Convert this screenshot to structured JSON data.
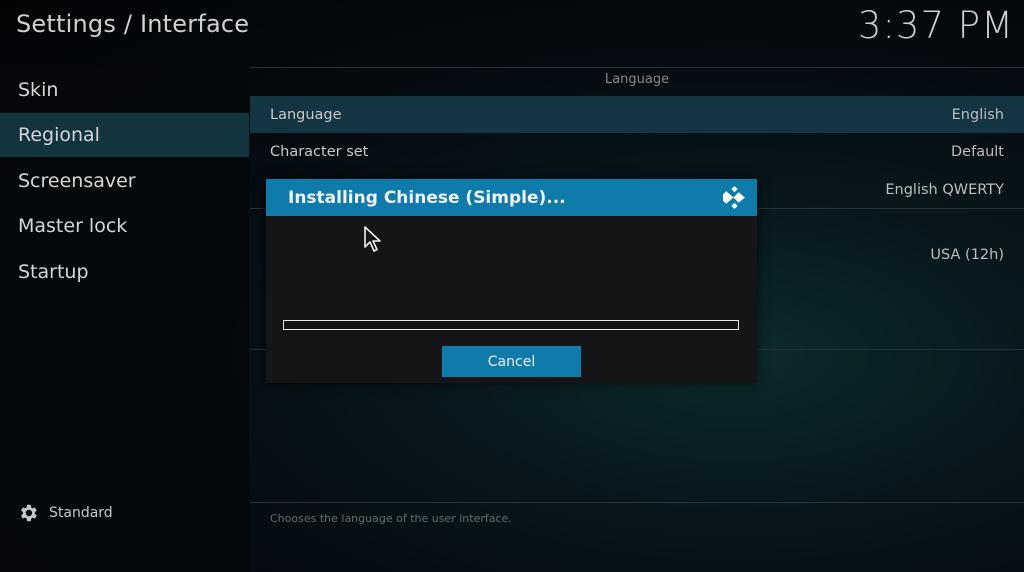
{
  "header": {
    "title": "Settings / Interface",
    "clock": "3:37 PM"
  },
  "sidebar": {
    "items": [
      {
        "label": "Skin",
        "active": false
      },
      {
        "label": "Regional",
        "active": true
      },
      {
        "label": "Screensaver",
        "active": false
      },
      {
        "label": "Master lock",
        "active": false
      },
      {
        "label": "Startup",
        "active": false
      }
    ],
    "footer": {
      "icon": "gear-icon",
      "label": "Standard"
    }
  },
  "main": {
    "section_header": "Language",
    "rows": [
      {
        "label": "Language",
        "value": "English"
      },
      {
        "label": "Character set",
        "value": "Default"
      },
      {
        "label": "",
        "value": "English QWERTY"
      },
      {
        "label": "",
        "value": "USA (12h)"
      }
    ],
    "description": "Chooses the language of the user interface."
  },
  "dialog": {
    "title": "Installing Chinese (Simple)...",
    "logo_icon": "kodi-logo-icon",
    "progress": 0,
    "cancel_label": "Cancel"
  },
  "colors": {
    "accent": "#0f7bab",
    "sidebar_active": "#12343f",
    "row_focus": "#123541"
  }
}
